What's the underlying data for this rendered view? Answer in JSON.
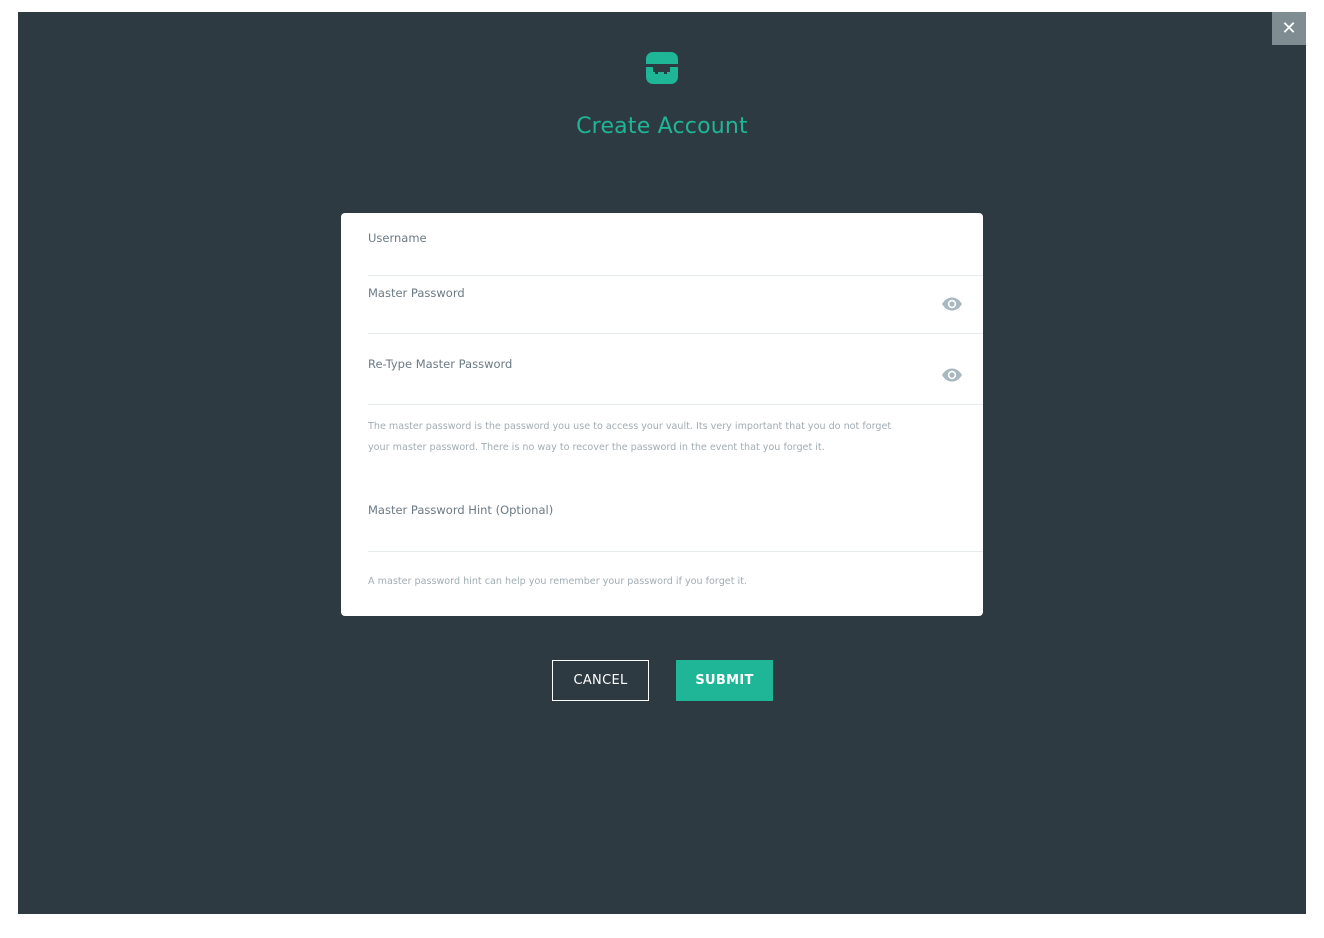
{
  "window": {
    "close_label": "✕"
  },
  "header": {
    "logo_icon": "vault-logo-icon",
    "title": "Create Account"
  },
  "form": {
    "username": {
      "label": "Username",
      "value": "",
      "placeholder": ""
    },
    "master_password": {
      "label": "Master Password",
      "value": "",
      "placeholder": "",
      "toggle_icon": "eye-icon"
    },
    "retype_password": {
      "label": "Re-Type Master Password",
      "value": "",
      "placeholder": "",
      "toggle_icon": "eye-icon"
    },
    "password_help": "The master password is the password you use to access your vault. Its very important that you do not forget your master password. There is no way to recover the password in the event that you forget it.",
    "hint": {
      "label": "Master Password Hint (Optional)",
      "value": "",
      "placeholder": ""
    },
    "hint_help": "A master password hint can help you remember your password if you forget it."
  },
  "actions": {
    "cancel_label": "CANCEL",
    "submit_label": "SUBMIT"
  },
  "colors": {
    "background": "#2d3a41",
    "accent": "#1fb597",
    "close_button": "#7f8c92",
    "card": "#ffffff"
  }
}
